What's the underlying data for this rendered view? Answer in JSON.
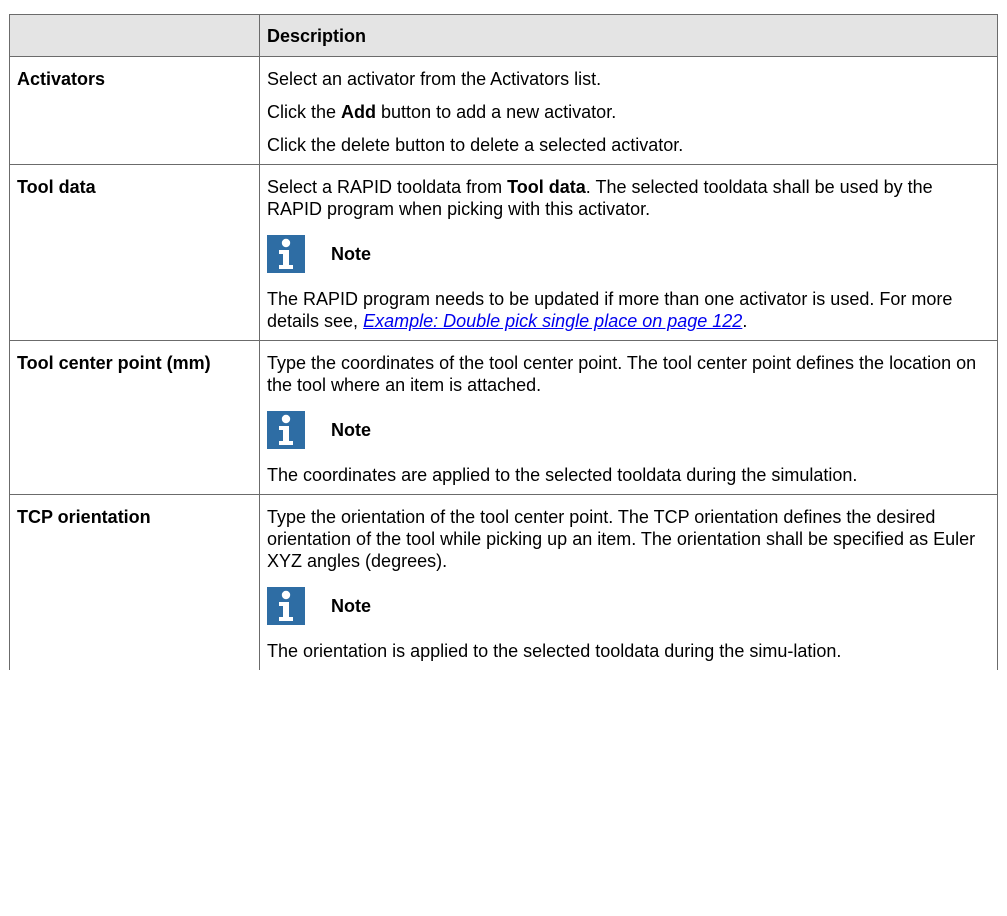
{
  "header": {
    "col1": "",
    "col2": "Description"
  },
  "rows": [
    {
      "label": "Activators",
      "p1": "Select an activator from the Activators list.",
      "p2_pre": "Click the ",
      "p2_bold": "Add",
      "p2_post": " button to add a new activator.",
      "p3": "Click the delete button to delete a selected activator."
    },
    {
      "label": "Tool data",
      "p1_pre": "Select a RAPID tooldata from ",
      "p1_bold": "Tool data",
      "p1_post": ". The selected tooldata shall be used by the RAPID program when picking with this activator.",
      "note_title": "Note",
      "note_text_pre": "The RAPID program needs to be updated if more than one activator is used. For more details see, ",
      "note_link": "Example: Double pick single place on page 122",
      "note_text_post": "."
    },
    {
      "label": "Tool center point (mm)",
      "p1": "Type the coordinates of the tool center point. The tool center point defines the location on the tool where an item is attached.",
      "note_title": "Note",
      "note_text": "The coordinates are applied to the selected tooldata during the simulation."
    },
    {
      "label": "TCP orientation",
      "p1": "Type the orientation of the tool center point. The TCP orientation defines the desired orientation of the tool while picking up an item. The orientation shall be specified as Euler XYZ angles (degrees).",
      "note_title": "Note",
      "note_text": "The orientation is applied to the selected tooldata during the simu-lation."
    }
  ],
  "icons": {
    "note": "info-icon"
  },
  "colors": {
    "note_icon_bg": "#2e6da4",
    "header_bg": "#e4e4e4",
    "link": "#0000ee"
  }
}
